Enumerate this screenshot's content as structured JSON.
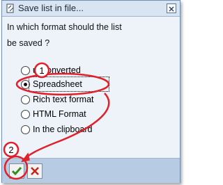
{
  "dialog": {
    "title": "Save list in file...",
    "title_icon": "page-icon",
    "close_icon": "close-icon",
    "question_line1": "In which format should the list",
    "question_line2": "be saved ?"
  },
  "format_options": [
    {
      "label": "unconverted",
      "selected": false
    },
    {
      "label": "Spreadsheet",
      "selected": true
    },
    {
      "label": "Rich text format",
      "selected": false
    },
    {
      "label": "HTML Format",
      "selected": false
    },
    {
      "label": "In the clipboard",
      "selected": false
    }
  ],
  "footer": {
    "ok_icon": "checkmark-icon",
    "cancel_icon": "cancel-x-icon"
  },
  "annotations": {
    "step1": "1",
    "step2": "2",
    "highlight_color": "#e0202a"
  },
  "colors": {
    "dialog_background": "#eef3fa",
    "titlebar": "#d8e4f2",
    "footer": "#b7cbe3",
    "ok_green": "#2e8f1e",
    "cancel_red": "#c4261c"
  }
}
